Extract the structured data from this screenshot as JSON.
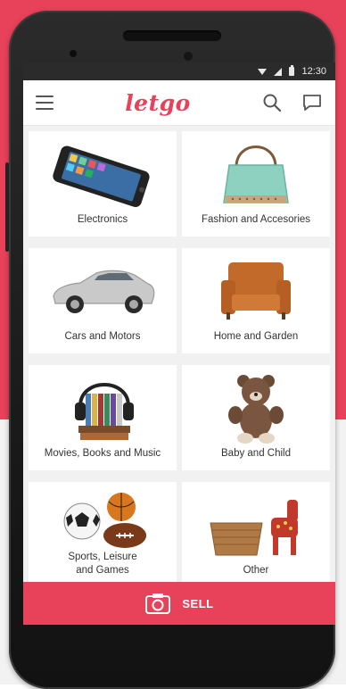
{
  "status_bar": {
    "time": "12:30"
  },
  "app_bar": {
    "logo": "letgo"
  },
  "categories": [
    {
      "label": "Electronics"
    },
    {
      "label": "Fashion and Accesories"
    },
    {
      "label": "Cars and Motors"
    },
    {
      "label": "Home and Garden"
    },
    {
      "label": "Movies, Books and Music"
    },
    {
      "label": "Baby and Child"
    },
    {
      "label": "Sports, Leisure\nand Games"
    },
    {
      "label": "Other"
    }
  ],
  "sell_button": {
    "label": "SELL",
    "icon": "camera-icon"
  },
  "colors": {
    "accent": "#e8425a",
    "status_bar": "#2b2b2b",
    "phone_body": "#1a1a1a"
  }
}
